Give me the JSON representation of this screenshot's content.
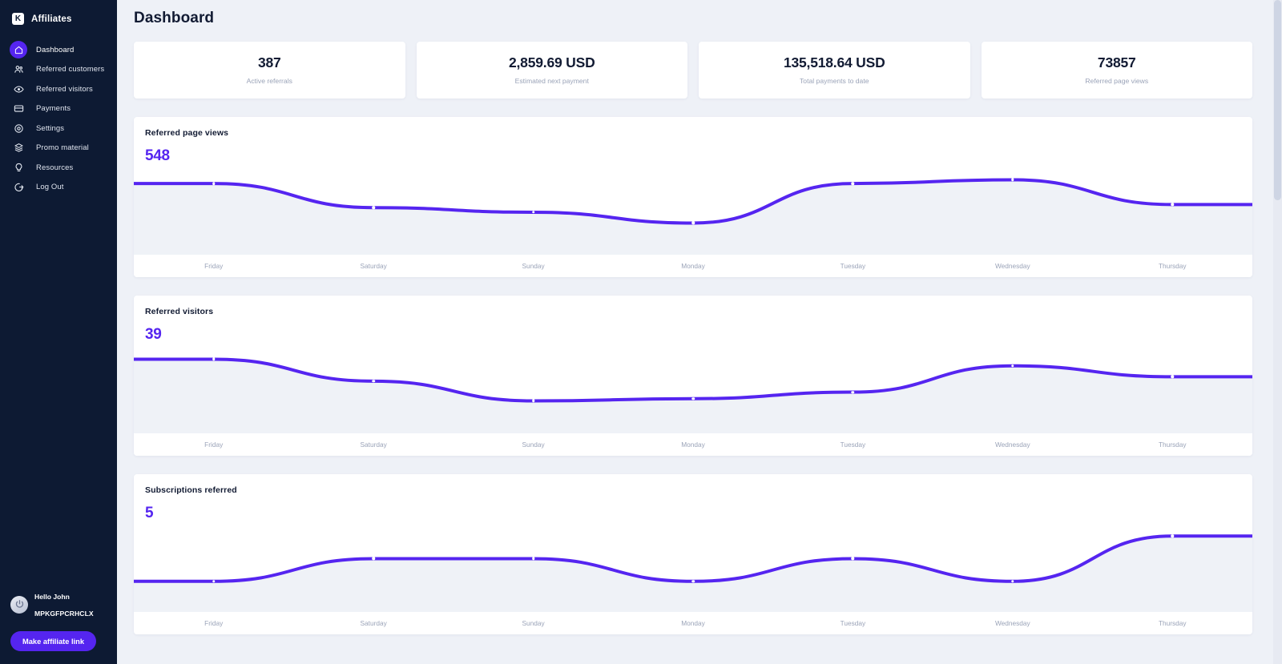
{
  "sidebar": {
    "brand": {
      "logo_letter": "K",
      "name": "Affiliates"
    },
    "items": [
      {
        "label": "Dashboard",
        "icon": "home-icon",
        "active": true
      },
      {
        "label": "Referred customers",
        "icon": "people-icon",
        "active": false
      },
      {
        "label": "Referred visitors",
        "icon": "eye-icon",
        "active": false
      },
      {
        "label": "Payments",
        "icon": "credit-card-icon",
        "active": false
      },
      {
        "label": "Settings",
        "icon": "gear-icon",
        "active": false
      },
      {
        "label": "Promo material",
        "icon": "layers-icon",
        "active": false
      },
      {
        "label": "Resources",
        "icon": "lightbulb-icon",
        "active": false
      },
      {
        "label": "Log Out",
        "icon": "logout-icon",
        "active": false
      }
    ],
    "user": {
      "greeting": "Hello John",
      "code": "MPKGFPCRHCLX",
      "avatar_icon": "user-avatar-icon"
    },
    "cta_label": "Make affiliate link"
  },
  "header": {
    "title": "Dashboard"
  },
  "stats": [
    {
      "value": "387",
      "label": "Active referrals"
    },
    {
      "value": "2,859.69 USD",
      "label": "Estimated next payment"
    },
    {
      "value": "135,518.64 USD",
      "label": "Total payments to date"
    },
    {
      "value": "73857",
      "label": "Referred page views"
    }
  ],
  "colors": {
    "accent": "#5525f0",
    "sidebar_bg": "#0d1a33",
    "page_bg": "#eef1f7",
    "card_bg": "#ffffff",
    "area_fill": "#eff2f7",
    "muted_text": "#9aa3b8",
    "dark_text": "#121b33"
  },
  "chart_data": [
    {
      "type": "area",
      "title": "Referred page views",
      "headline_value": "548",
      "xlabel": "",
      "ylabel": "",
      "grid": false,
      "legend": "none",
      "categories": [
        "Friday",
        "Saturday",
        "Sunday",
        "Monday",
        "Tuesday",
        "Wednesday",
        "Thursday"
      ],
      "values": [
        548,
        470,
        455,
        420,
        548,
        560,
        480
      ],
      "ylim": [
        380,
        600
      ],
      "line_color": "#5525f0",
      "fill_color": "#eff2f7",
      "point_marker": "white-dot"
    },
    {
      "type": "area",
      "title": "Referred visitors",
      "headline_value": "39",
      "xlabel": "",
      "ylabel": "",
      "grid": false,
      "legend": "none",
      "categories": [
        "Friday",
        "Saturday",
        "Sunday",
        "Monday",
        "Tuesday",
        "Wednesday",
        "Thursday"
      ],
      "values": [
        39,
        29,
        20,
        21,
        24,
        36,
        31
      ],
      "ylim": [
        14,
        45
      ],
      "line_color": "#5525f0",
      "fill_color": "#eff2f7",
      "point_marker": "white-dot"
    },
    {
      "type": "area",
      "title": "Subscriptions referred",
      "headline_value": "5",
      "xlabel": "",
      "ylabel": "",
      "grid": false,
      "legend": "none",
      "categories": [
        "Friday",
        "Saturday",
        "Sunday",
        "Monday",
        "Tuesday",
        "Wednesday",
        "Thursday"
      ],
      "values": [
        1,
        3,
        3,
        1,
        3,
        1,
        5
      ],
      "ylim": [
        0,
        6
      ],
      "line_color": "#5525f0",
      "fill_color": "#eff2f7",
      "point_marker": "white-dot"
    }
  ]
}
